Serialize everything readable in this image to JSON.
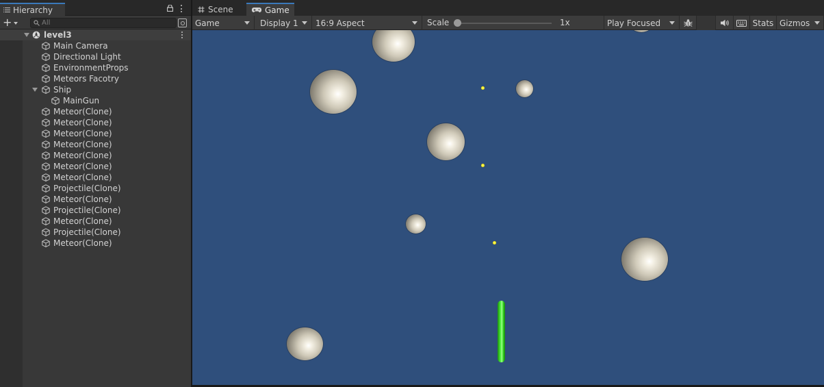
{
  "hierarchy": {
    "tab_label": "Hierarchy",
    "add_label": "+",
    "search_placeholder": "All",
    "scene": {
      "name": "level3",
      "items": [
        {
          "name": "Main Camera",
          "depth": 1
        },
        {
          "name": "Directional Light",
          "depth": 1
        },
        {
          "name": "EnvironmentProps",
          "depth": 1
        },
        {
          "name": "Meteors Facotry",
          "depth": 1
        },
        {
          "name": "Ship",
          "depth": 1,
          "expanded": true
        },
        {
          "name": "MainGun",
          "depth": 2
        },
        {
          "name": "Meteor(Clone)",
          "depth": 1
        },
        {
          "name": "Meteor(Clone)",
          "depth": 1
        },
        {
          "name": "Meteor(Clone)",
          "depth": 1
        },
        {
          "name": "Meteor(Clone)",
          "depth": 1
        },
        {
          "name": "Meteor(Clone)",
          "depth": 1
        },
        {
          "name": "Meteor(Clone)",
          "depth": 1
        },
        {
          "name": "Meteor(Clone)",
          "depth": 1
        },
        {
          "name": "Projectile(Clone)",
          "depth": 1
        },
        {
          "name": "Meteor(Clone)",
          "depth": 1
        },
        {
          "name": "Projectile(Clone)",
          "depth": 1
        },
        {
          "name": "Meteor(Clone)",
          "depth": 1
        },
        {
          "name": "Projectile(Clone)",
          "depth": 1
        },
        {
          "name": "Meteor(Clone)",
          "depth": 1
        }
      ]
    }
  },
  "view_tabs": {
    "scene_label": "Scene",
    "game_label": "Game"
  },
  "game_toolbar": {
    "view_mode": "Game",
    "display": "Display 1",
    "aspect": "16:9 Aspect",
    "scale_label": "Scale",
    "scale_value": "1x",
    "scale_fraction": 0.0,
    "play_mode": "Play Focused",
    "stats_label": "Stats",
    "gizmos_label": "Gizmos"
  },
  "colors": {
    "accent_tab": "#3a79bb",
    "game_background": "#2f4f7c",
    "ship": "#3ee02a",
    "projectile": "#f2e200"
  },
  "icons": [
    "list-icon",
    "lock-icon",
    "kebab-menu-icon",
    "search-icon",
    "scene-icon",
    "cube-icon",
    "grid-icon",
    "gamepad-icon",
    "bug-icon",
    "speaker-icon",
    "keyboard-icon"
  ]
}
